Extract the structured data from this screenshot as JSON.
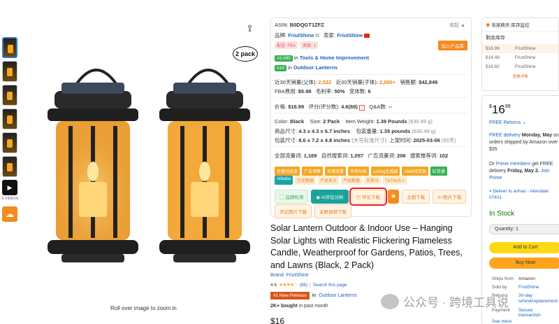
{
  "thumbnails": {
    "count": 7,
    "videos_label": "6 VIDEOS"
  },
  "image": {
    "badge": "2 pack",
    "rollover_text": "Roll over image to zoom in"
  },
  "info": {
    "asin_label": "ASIN:",
    "asin": "B0DQGT1ZFZ",
    "collapse": "收起 ▲",
    "brand_label": "品牌:",
    "brand": "FriutShine",
    "seller_label": "卖家:",
    "seller": "FriutShine",
    "tags": [
      "配送: FBA",
      "卖家: 1"
    ],
    "add_product": "加入产品库",
    "rank1_no": "#3,085",
    "rank1_in": "in",
    "rank1_cat": "Tools & Home Improvement",
    "rank2_no": "#16",
    "rank2_in": "in",
    "rank2_cat": "Outdoor Lanterns",
    "sales_parent_label": "近30天销量(父体):",
    "sales_parent": "2,522",
    "sales_child_label": "近30天销量(子体):",
    "sales_child": "2,000+",
    "revenue_label": "销售额:",
    "revenue": "$42,849",
    "fba_label": "FBA费用:",
    "fba": "$5.98",
    "margin_label": "毛利率:",
    "margin": "50%",
    "variants_label": "变体数:",
    "variants": "6",
    "price_label": "价格:",
    "price": "$16.99",
    "rating_label": "评分(评分数):",
    "rating": "4.6(88)",
    "qa_label": "Q&A数:",
    "qa": "--",
    "color_label": "Color:",
    "color": "Black",
    "size_label": "Size:",
    "size": "2 Pack",
    "weight_label": "Item Weight:",
    "weight": "1.39 Pounds",
    "weight_g": "(630.49 g)",
    "dims_label": "商品尺寸:",
    "dims": "4.3 x 4.3 x 6.7 inches",
    "pkg_weight_label": "包装重量:",
    "pkg_weight": "1.39 pounds",
    "pkg_weight_g": "(630.49 g)",
    "pkg_dims_label": "包装尺寸:",
    "pkg_dims": "8.6 x 7.2 x 4.8 inches",
    "pkg_dims_note": "(大号标准尺寸)",
    "launch_label": "上架时间:",
    "launch": "2025-03-06",
    "launch_days": "(55天)",
    "search_all_label": "全部流量词:",
    "search_all": "1,169",
    "search_natural_label": "自然搜索词:",
    "search_natural": "1,057",
    "search_ad_label": "广告流量词:",
    "search_ad": "206",
    "search_rec_label": "搜索推荐词:",
    "search_rec": "102",
    "chips1": [
      "关键词反查",
      "广告洞察",
      "关键流量",
      "市场分析",
      "Listing生成器",
      "1688找货源",
      "缸货通"
    ],
    "chips2": [
      "Alibaba",
      "历史数据",
      "产品卖点",
      "产品数据",
      "优差分",
      "TikTok达人"
    ],
    "btn_check": "品牌检测",
    "btn_ai": "AI评论分析",
    "btn_review": "评论下载",
    "btn_main": "主图下载",
    "btn_aplus": "A+图片下载",
    "btn_review_img": "评论图片下载",
    "btn_related": "关联视频下载"
  },
  "product": {
    "title": "Solar Lantern Outdoor & Indoor Use – Hanging Solar Lights with Realistic Flickering Flameless Candle, Weatherproof for Gardens, Patios, Trees, and Lawns (Black, 2 Pack)",
    "brand": "Brand: FriutShine",
    "rating": "4.6",
    "stars": "★★★★☆",
    "ratings_count": "(88)",
    "search_page": "Search this page",
    "new_release": "#1 New Release",
    "nr_in": "in",
    "nr_cat": "Outdoor Lanterns",
    "bought_bold": "2K+ bought",
    "bought_rest": "in past month",
    "price_partial": "$16"
  },
  "inventory": {
    "header": "卖家精灵-库存监控",
    "title": "剩余库存",
    "rows": [
      {
        "price": "$16.99",
        "seller": "FriutShine"
      },
      {
        "price": "$16.48",
        "seller": "FriutShine"
      },
      {
        "price": "$16.82",
        "seller": "FriutShine"
      }
    ],
    "link": "查看详情"
  },
  "buybox": {
    "price_symbol": "$",
    "price_whole": "16",
    "price_frac": "99",
    "free_returns": "FREE Returns ⌄",
    "delivery_link": "FREE delivery",
    "delivery_date": "Monday, May",
    "delivery_rest": "on orders shipped by Amazon over $35",
    "prime_prefix": "Or",
    "prime_link": "Prime members",
    "prime_rest": "get FREE delivery",
    "prime_date": "Friday, May 2.",
    "prime_join": "Join Prime",
    "deliver_to": "Deliver to anhao - Allendale 07401",
    "stock": "In Stock",
    "quantity": "Quantity: 1",
    "add_to_cart": "Add to Cart",
    "buy_now": "Buy Now",
    "ships_from_label": "Ships from",
    "ships_from": "Amazon",
    "sold_by_label": "Sold by",
    "sold_by": "FriutShine",
    "returns_label": "Returns",
    "returns": "30-day refund/replacement",
    "payment_label": "Payment",
    "payment": "Secure transaction",
    "see_more": "See more"
  },
  "watermark": "公众号 · 跨境工具说"
}
